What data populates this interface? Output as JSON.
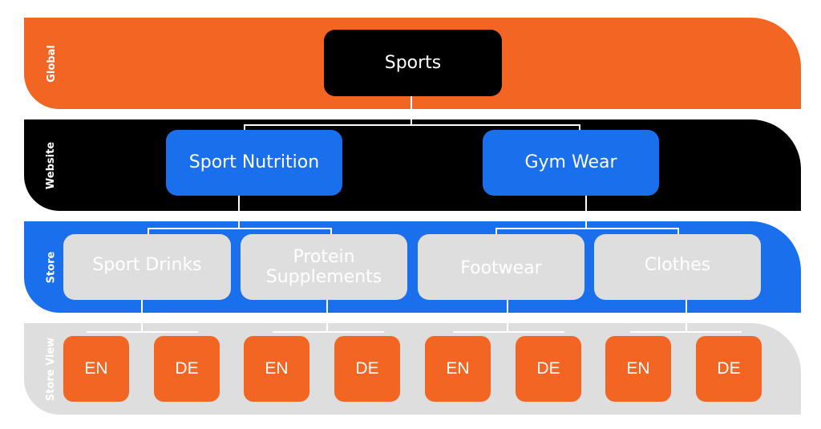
{
  "colors": {
    "global": "#f26522",
    "website": "#000000",
    "store": "#1a6fec",
    "store_view": "#dedede",
    "website_node": "#1a6fec",
    "store_view_node": "#f26522"
  },
  "levels": [
    {
      "label": "Global"
    },
    {
      "label": "Website"
    },
    {
      "label": "Store"
    },
    {
      "label": "Store View"
    }
  ],
  "tree": {
    "global": {
      "label": "Sports"
    },
    "websites": [
      {
        "label": "Sport Nutrition",
        "stores": [
          {
            "label": "Sport Drinks",
            "views": [
              {
                "label": "EN"
              },
              {
                "label": "DE"
              }
            ]
          },
          {
            "label": "Protein Supplements",
            "views": [
              {
                "label": "EN"
              },
              {
                "label": "DE"
              }
            ]
          }
        ]
      },
      {
        "label": "Gym Wear",
        "stores": [
          {
            "label": "Footwear",
            "views": [
              {
                "label": "EN"
              },
              {
                "label": "DE"
              }
            ]
          },
          {
            "label": "Clothes",
            "views": [
              {
                "label": "EN"
              },
              {
                "label": "DE"
              }
            ]
          }
        ]
      }
    ]
  }
}
